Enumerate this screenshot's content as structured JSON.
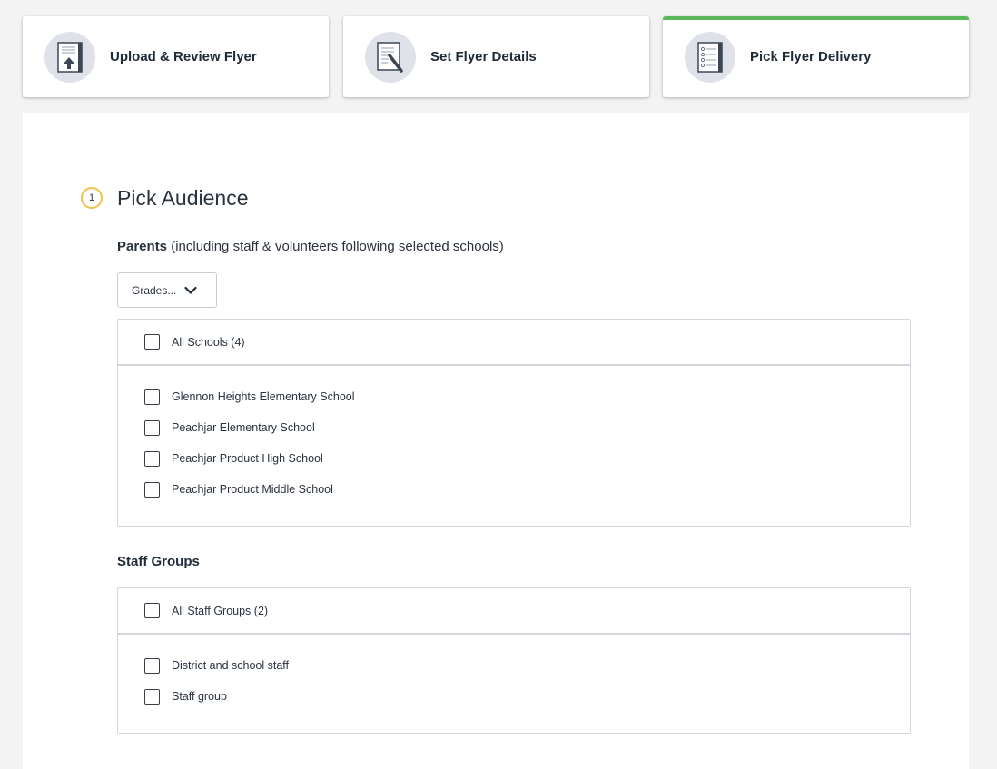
{
  "steps": [
    {
      "label": "Upload & Review Flyer",
      "icon": "upload-document-icon"
    },
    {
      "label": "Set Flyer Details",
      "icon": "edit-document-icon"
    },
    {
      "label": "Pick Flyer Delivery",
      "icon": "checklist-document-icon",
      "active": true
    }
  ],
  "active_color": "#5cb85c",
  "section": {
    "number": "1",
    "title": "Pick Audience"
  },
  "parents": {
    "label_bold": "Parents",
    "label_rest": " (including staff & volunteers following selected schools)",
    "grades_button": "Grades...",
    "all_label": "All Schools (4)",
    "schools": [
      "Glennon Heights Elementary School",
      "Peachjar Elementary School",
      "Peachjar Product High School",
      "Peachjar Product Middle School"
    ]
  },
  "staff": {
    "title": "Staff Groups",
    "all_label": "All Staff Groups (2)",
    "groups": [
      "District and school staff",
      "Staff group"
    ]
  }
}
